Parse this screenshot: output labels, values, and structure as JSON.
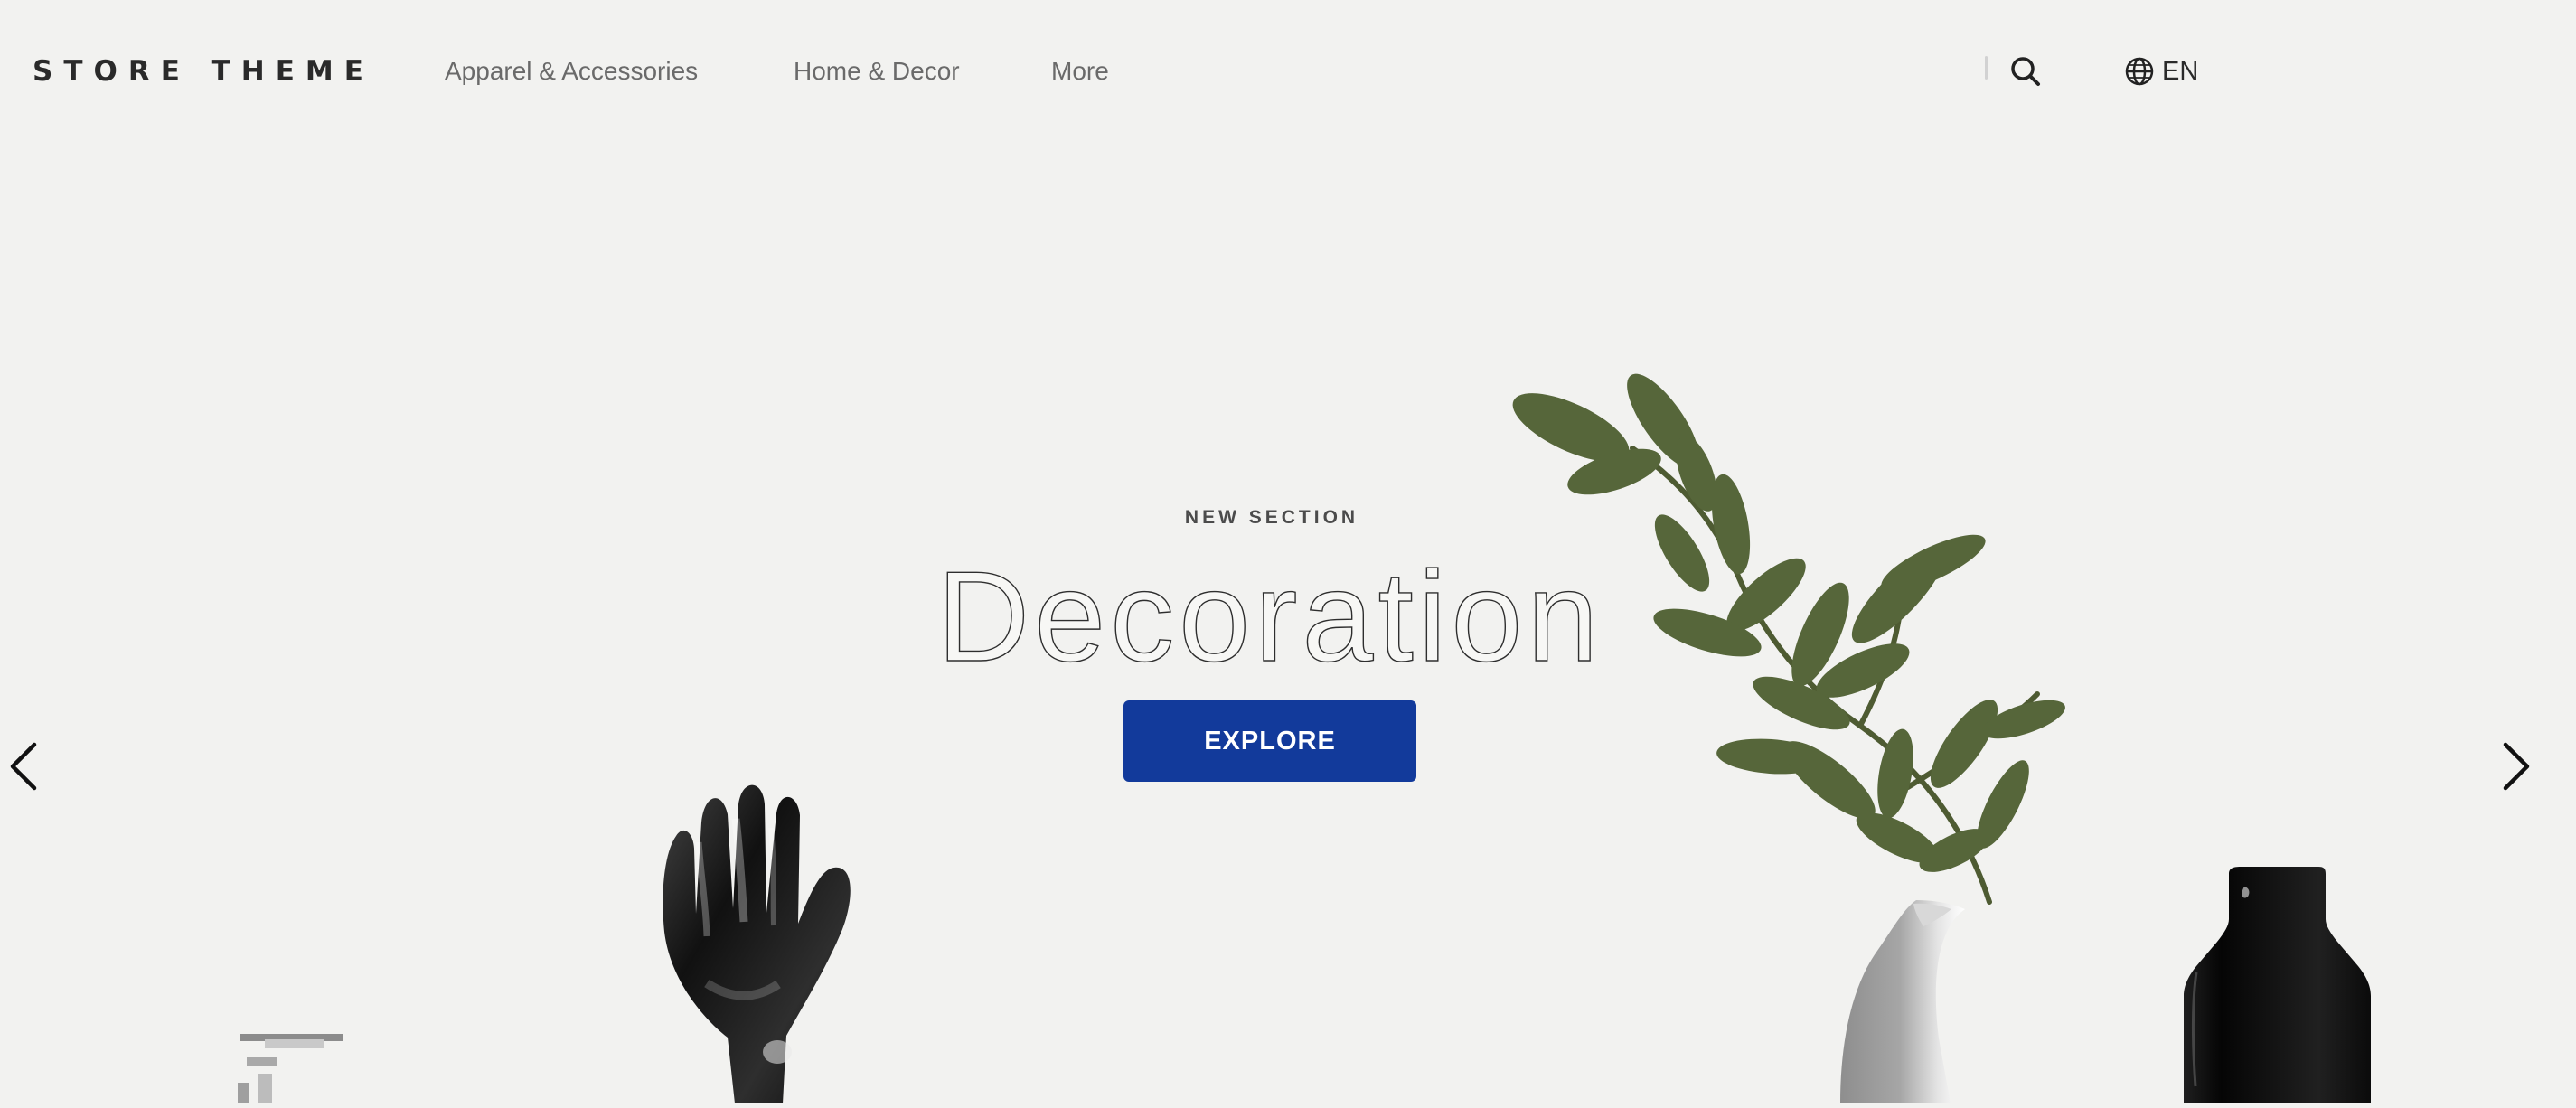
{
  "header": {
    "brand": "STORE THEME",
    "nav": [
      "Apparel & Accessories",
      "Home & Decor",
      "More"
    ],
    "language": {
      "code": "EN",
      "icon": "globe-icon"
    },
    "search_icon": "search-icon"
  },
  "hero": {
    "kicker": "NEW SECTION",
    "title": "Decoration",
    "cta_label": "EXPLORE",
    "prev_icon": "chevron-left-icon",
    "next_icon": "chevron-right-icon"
  },
  "colors": {
    "background": "#f2f2f0",
    "accent": "#123a9b",
    "text": "#2b2b2b"
  }
}
